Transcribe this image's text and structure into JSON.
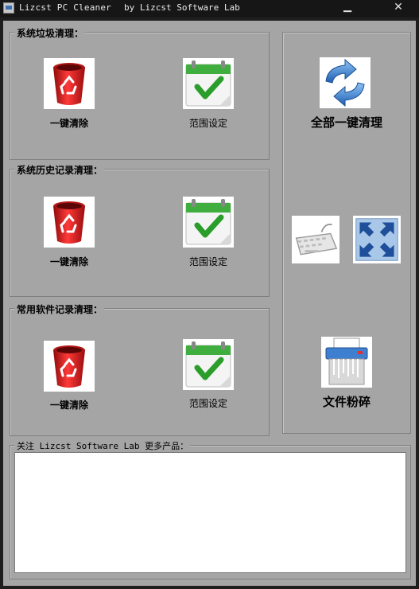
{
  "window": {
    "app_name": "Lizcst PC Cleaner",
    "by_line": "by Lizcst Software Lab",
    "minimize_glyph": "▁",
    "close_glyph": "✕"
  },
  "groups": [
    {
      "title": "系统垃圾清理：",
      "clean_label": "一键清除",
      "range_label": "范围设定"
    },
    {
      "title": "系统历史记录清理：",
      "clean_label": "一键清除",
      "range_label": "范围设定"
    },
    {
      "title": "常用软件记录清理：",
      "clean_label": "一键清除",
      "range_label": "范围设定"
    }
  ],
  "right_panel": {
    "clean_all_label": "全部一键清理",
    "shred_label": "文件粉碎"
  },
  "follow": {
    "title": "关注 Lizcst Software Lab 更多产品：",
    "content": ""
  },
  "colors": {
    "client_bg": "#a5a5a5",
    "titlebar_bg": "#161616",
    "trash_red": "#d62020",
    "check_green": "#2a9d2a"
  },
  "icons": {
    "trash": "trash-can-icon",
    "calendar": "calendar-check-icon",
    "refresh": "refresh-arrows-icon",
    "keyboard": "keyboard-icon",
    "fullscreen": "fullscreen-icon",
    "shredder": "paper-shredder-icon"
  }
}
